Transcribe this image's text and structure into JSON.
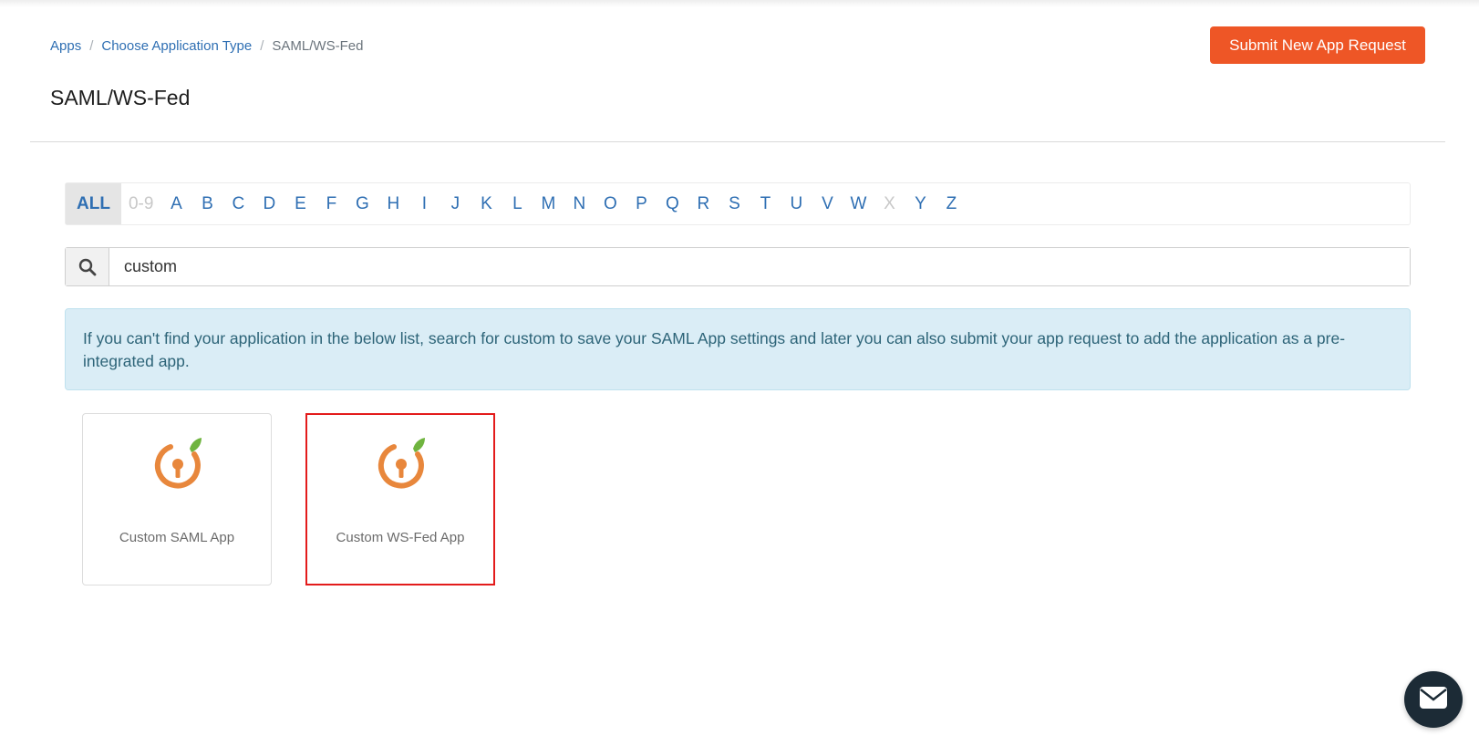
{
  "breadcrumb": {
    "items": [
      "Apps",
      "Choose Application Type"
    ],
    "separator": "/",
    "current": "SAML/WS-Fed"
  },
  "header": {
    "submit_label": "Submit New App Request",
    "title": "SAML/WS-Fed"
  },
  "alpha_filter": {
    "letters": [
      "ALL",
      "0-9",
      "A",
      "B",
      "C",
      "D",
      "E",
      "F",
      "G",
      "H",
      "I",
      "J",
      "K",
      "L",
      "M",
      "N",
      "O",
      "P",
      "Q",
      "R",
      "S",
      "T",
      "U",
      "V",
      "W",
      "X",
      "Y",
      "Z"
    ],
    "active": "ALL",
    "disabled": [
      "0-9",
      "X"
    ]
  },
  "search": {
    "value": "custom",
    "icon": "search-icon"
  },
  "info": {
    "message": "If you can't find your application in the below list, search for custom to save your SAML App settings and later you can also submit your app request to add the application as a pre-integrated app."
  },
  "apps": [
    {
      "name": "Custom SAML App",
      "icon": "app-keyhole-icon",
      "selected": false
    },
    {
      "name": "Custom WS-Fed App",
      "icon": "app-keyhole-icon",
      "selected": true
    }
  ],
  "colors": {
    "accent": "#ee5626",
    "link": "#2f6fb3",
    "info_bg": "#daedf6",
    "selected_border": "#e31b1b",
    "logo_orange": "#e8873c",
    "logo_green": "#6fb43f",
    "chat_bg": "#1c2b36"
  },
  "chat": {
    "icon": "mail-icon"
  }
}
